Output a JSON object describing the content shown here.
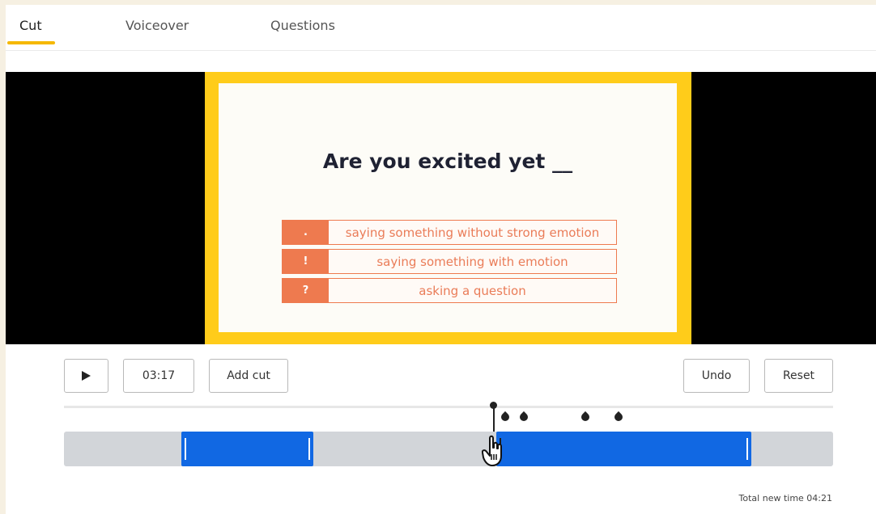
{
  "tabs": [
    {
      "label": "Cut",
      "active": true
    },
    {
      "label": "Voiceover",
      "active": false
    },
    {
      "label": "Questions",
      "active": false
    }
  ],
  "slide": {
    "title": "Are you excited yet __",
    "options": [
      {
        "key": ".",
        "text": "saying something without strong emotion"
      },
      {
        "key": "!",
        "text": "saying something with emotion"
      },
      {
        "key": "?",
        "text": "asking a question"
      }
    ]
  },
  "controls": {
    "play_icon": "play-icon",
    "time": "03:17",
    "add_cut_label": "Add cut",
    "undo_label": "Undo",
    "reset_label": "Reset"
  },
  "status": {
    "total_label": "Total new time 04:21"
  },
  "colors": {
    "accent_yellow": "#f5b800",
    "segment_blue": "#1168e3",
    "option_orange": "#ee7a4f"
  }
}
